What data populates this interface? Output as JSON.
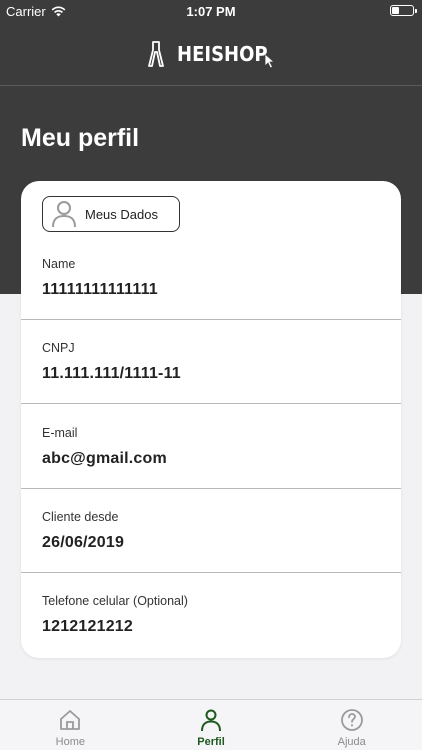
{
  "status_bar": {
    "carrier": "Carrier",
    "time": "1:07 PM",
    "icons": [
      "wifi-icon",
      "battery-icon"
    ]
  },
  "header": {
    "brand": "HEISHOP",
    "logo_icon": "hanger-icon"
  },
  "page": {
    "title": "Meu perfil"
  },
  "profile_tab": {
    "label": "Meus Dados",
    "icon": "person-icon"
  },
  "fields": [
    {
      "label": "Name",
      "value": "11111111111111"
    },
    {
      "label": "CNPJ",
      "value": "11.111.111/1111-11"
    },
    {
      "label": "E-mail",
      "value": "abc@gmail.com"
    },
    {
      "label": "Cliente desde",
      "value": "26/06/2019"
    },
    {
      "label": "Telefone celular (Optional)",
      "value": "1212121212"
    }
  ],
  "tab_bar": {
    "items": [
      {
        "label": "Home",
        "icon": "home-icon",
        "active": false
      },
      {
        "label": "Perfil",
        "icon": "person-icon",
        "active": true
      },
      {
        "label": "Ajuda",
        "icon": "help-icon",
        "active": false
      }
    ]
  },
  "colors": {
    "header_bg": "#3c3c3c",
    "accent": "#1e5a1e",
    "page_bg": "#f2f2f4"
  }
}
